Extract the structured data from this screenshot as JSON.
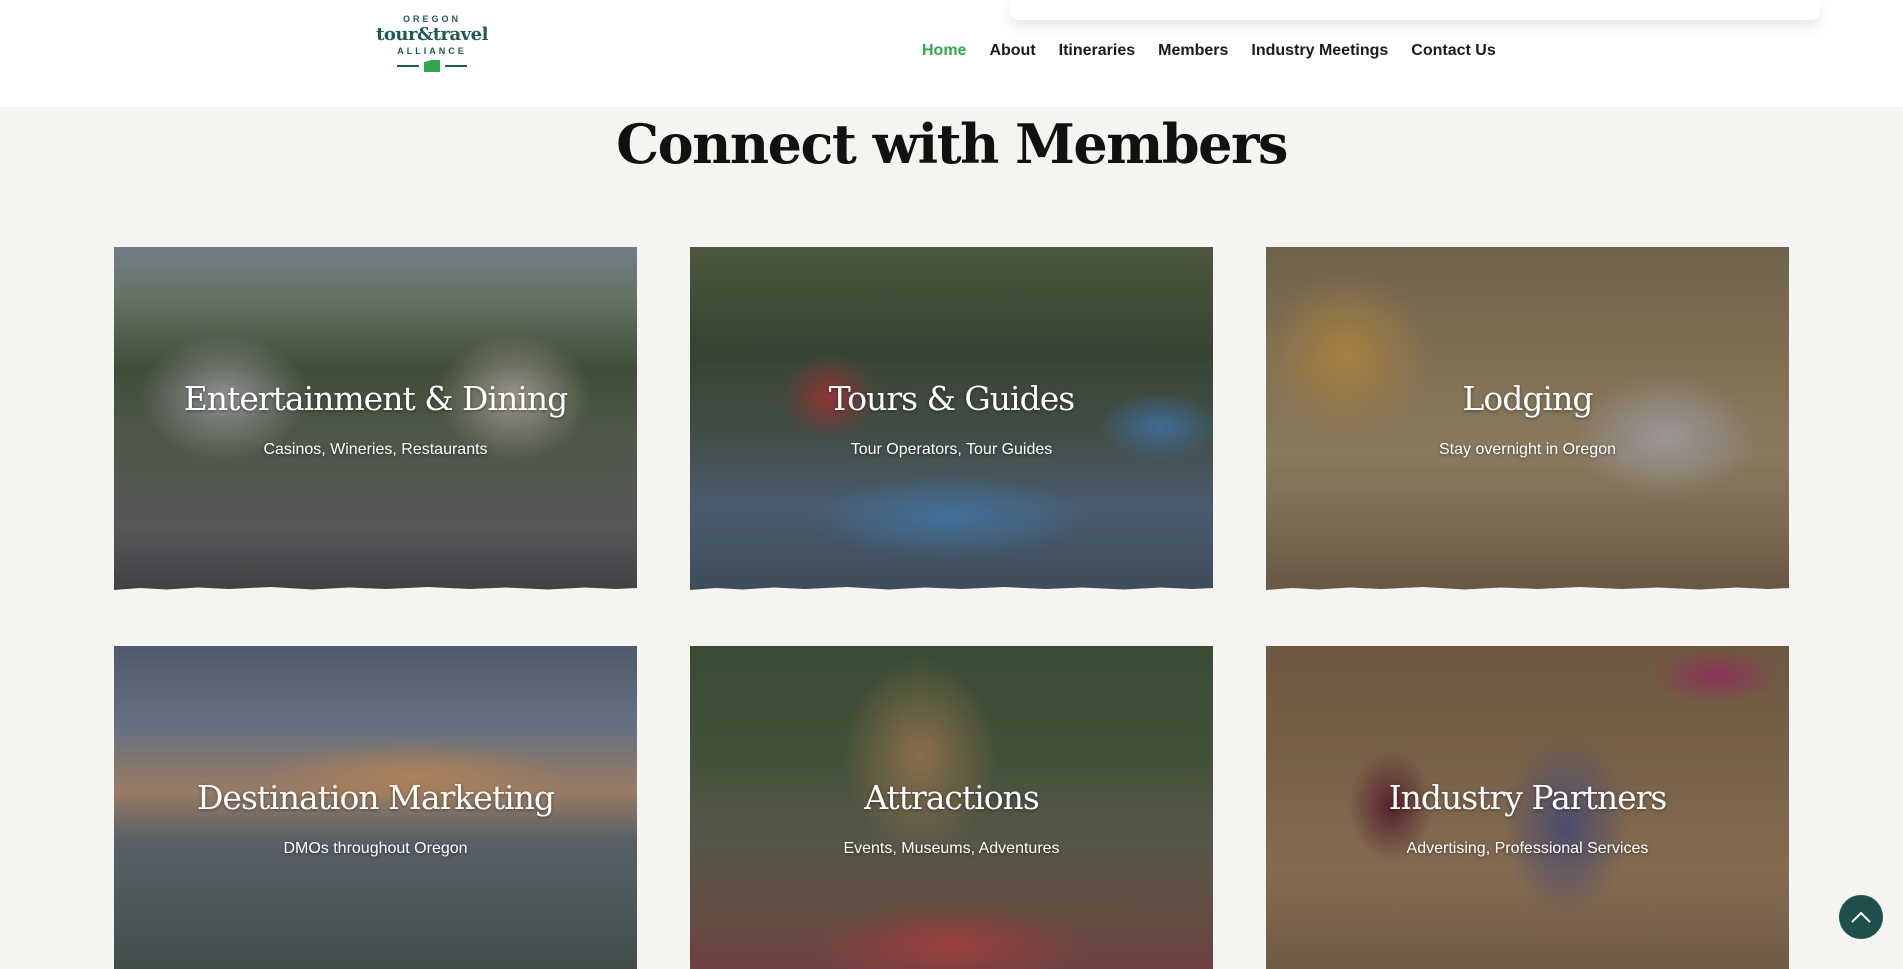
{
  "logo": {
    "line1": "OREGON",
    "line2": "tour&travel",
    "line3": "ALLIANCE"
  },
  "nav": [
    {
      "label": "Home",
      "active": true
    },
    {
      "label": "About"
    },
    {
      "label": "Itineraries"
    },
    {
      "label": "Members"
    },
    {
      "label": "Industry Meetings"
    },
    {
      "label": "Contact Us"
    }
  ],
  "colors": {
    "accent": "#2fa84f",
    "brand": "#1f5a53",
    "background": "#f5f4f0"
  },
  "section": {
    "title": "Connect with Members"
  },
  "cards": [
    {
      "title": "Entertainment & Dining",
      "subtitle": "Casinos, Wineries, Restaurants"
    },
    {
      "title": "Tours & Guides",
      "subtitle": "Tour Operators, Tour Guides"
    },
    {
      "title": "Lodging",
      "subtitle": "Stay overnight in Oregon"
    },
    {
      "title": "Destination Marketing",
      "subtitle": "DMOs throughout Oregon"
    },
    {
      "title": "Attractions",
      "subtitle": "Events, Museums, Adventures"
    },
    {
      "title": "Industry Partners",
      "subtitle": "Advertising, Professional Services"
    }
  ],
  "back_to_top": {
    "icon": "chevron-up-icon"
  }
}
